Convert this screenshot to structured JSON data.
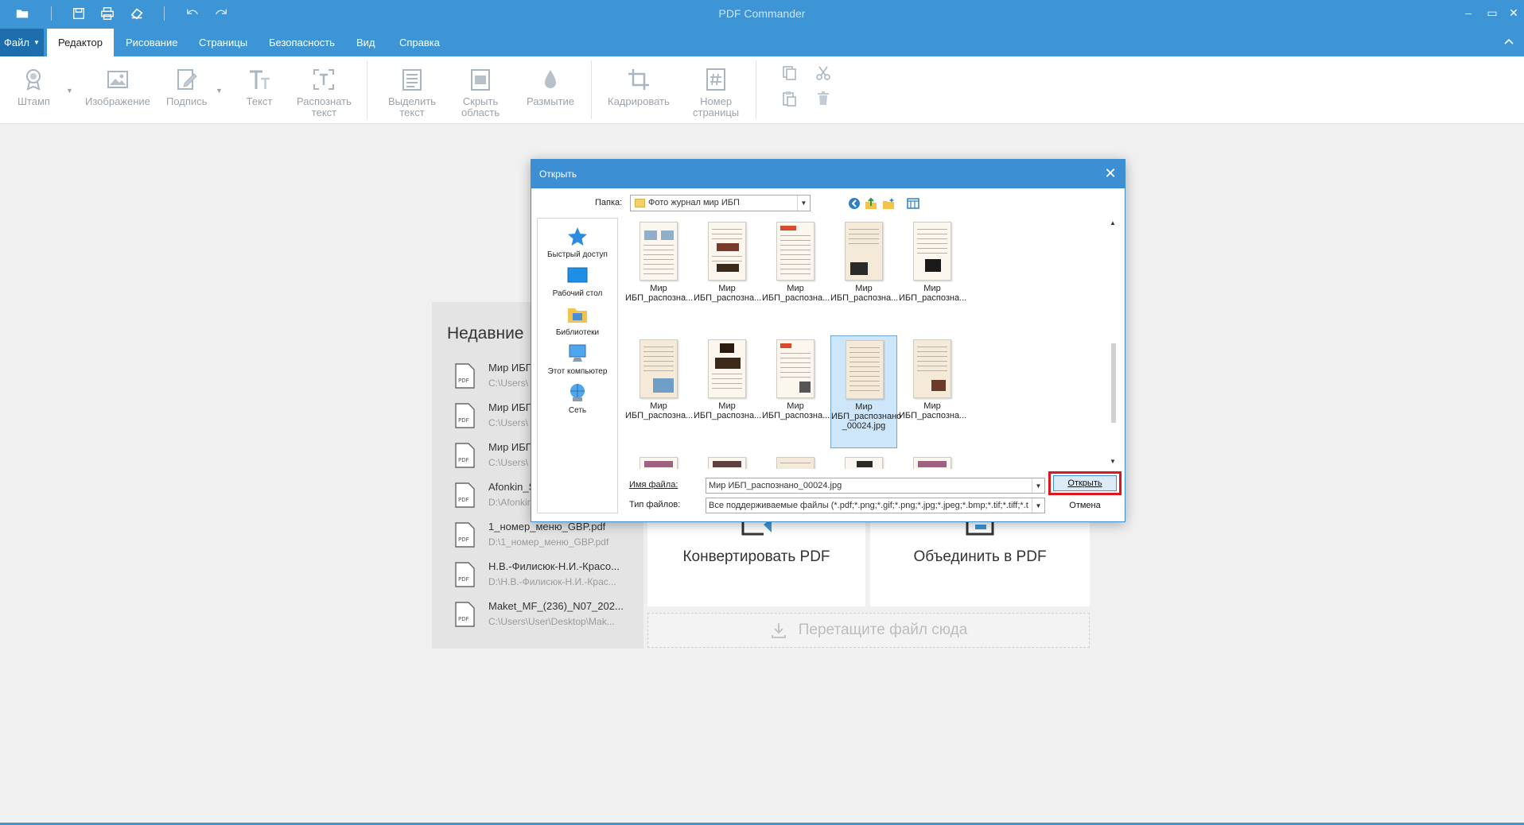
{
  "app": {
    "title": "PDF Commander",
    "window_buttons": [
      "–",
      "▭",
      "✕"
    ]
  },
  "menu": {
    "file_label": "Файл",
    "tabs": [
      "Редактор",
      "Рисование",
      "Страницы",
      "Безопасность",
      "Вид",
      "Справка"
    ],
    "active_tab": "Редактор"
  },
  "ribbon": {
    "stamp": "Штамп",
    "image": "Изображение",
    "signature": "Подпись",
    "text": "Текст",
    "ocr": [
      "Распознать",
      "текст"
    ],
    "highlight": [
      "Выделить",
      "текст"
    ],
    "hide_area": [
      "Скрыть",
      "область"
    ],
    "blur": "Размытие",
    "crop": "Кадрировать",
    "page_number": [
      "Номер",
      "страницы"
    ]
  },
  "start": {
    "recent_title": "Недавние",
    "recent": [
      {
        "name": "Мир ИБП",
        "path": "C:\\Users\\"
      },
      {
        "name": "Мир ИБП",
        "path": "C:\\Users\\"
      },
      {
        "name": "Мир ИБП",
        "path": "C:\\Users\\"
      },
      {
        "name": "Afonkin_S",
        "path": "D:\\Afonkin"
      },
      {
        "name": "1_номер_меню_GBP.pdf",
        "path": "D:\\1_номер_меню_GBP.pdf"
      },
      {
        "name": "Н.В.-Филисюк-Н.И.-Красо...",
        "path": "D:\\Н.В.-Филисюк-Н.И.-Крас..."
      },
      {
        "name": "Maket_MF_(236)_N07_202...",
        "path": "C:\\Users\\User\\Desktop\\Mak..."
      }
    ],
    "convert_label": "Конвертировать PDF",
    "merge_label": "Объединить в PDF",
    "drop_label": "Перетащите файл сюда"
  },
  "dialog": {
    "title": "Открыть",
    "folder_label": "Папка:",
    "folder_value": "Фото журнал мир ИБП",
    "places": [
      "Быстрый доступ",
      "Рабочий стол",
      "Библиотеки",
      "Этот компьютер",
      "Сеть"
    ],
    "files": [
      [
        "Мир",
        "ИБП_распозна..."
      ],
      [
        "Мир",
        "ИБП_распозна..."
      ],
      [
        "Мир",
        "ИБП_распозна..."
      ],
      [
        "Мир",
        "ИБП_распозна..."
      ],
      [
        "Мир",
        "ИБП_распозна..."
      ],
      [
        "Мир",
        "ИБП_распозна..."
      ],
      [
        "Мир",
        "ИБП_распозна..."
      ],
      [
        "Мир",
        "ИБП_распозна..."
      ],
      [
        "Мир",
        "ИБП_распознано",
        "_00024.jpg"
      ],
      [
        "Мир",
        "ИБП_распозна..."
      ]
    ],
    "selected_index": 8,
    "filename_label": "Имя файла:",
    "filename_value": "Мир ИБП_распознано_00024.jpg",
    "filetype_label": "Тип файлов:",
    "filetype_value": "Все поддерживаемые файлы (*.pdf;*.png;*.gif;*.png;*.jpg;*.jpeg;*.bmp;*.tif;*.tiff;*.t",
    "open_button": "Открыть",
    "cancel_button": "Отмена"
  },
  "colors": {
    "accent": "#3d95d6",
    "file_button": "#1e6eae",
    "highlight_box": "#e0161e"
  }
}
